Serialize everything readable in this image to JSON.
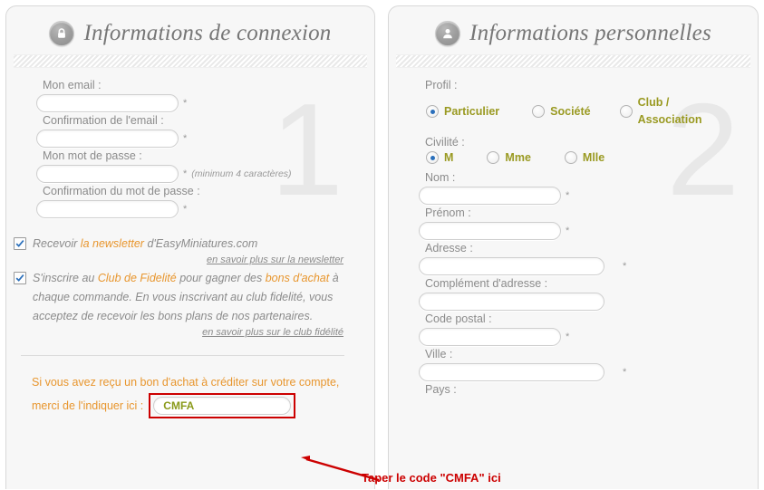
{
  "left_panel": {
    "icon": "lock-icon",
    "title": "Informations de connexion",
    "watermark": "1",
    "fields": [
      {
        "label": "Mon email :",
        "value": "",
        "required": "*",
        "hint": ""
      },
      {
        "label": "Confirmation de l'email :",
        "value": "",
        "required": "*",
        "hint": ""
      },
      {
        "label": "Mon mot de passe :",
        "value": "",
        "required": "*",
        "hint": "(minimum 4 caractères)"
      },
      {
        "label": "Confirmation du mot de passe :",
        "value": "",
        "required": "*",
        "hint": ""
      }
    ],
    "newsletter": {
      "checked": true,
      "text_before": "Recevoir ",
      "text_highlight": "la newsletter",
      "text_after": " d'EasyMiniatures.com",
      "link": "en savoir plus sur la newsletter"
    },
    "loyalty": {
      "checked": true,
      "seg1": "S'inscrire au ",
      "seg2": "Club de Fidelité",
      "seg3": " pour gagner des ",
      "seg4": "bons d'achat",
      "seg5": " à chaque commande. En vous inscrivant au club fidelité, vous acceptez de recevoir les bons plans de nos partenaires.",
      "link": "en savoir plus sur le club fidélité"
    },
    "voucher": {
      "line1": "Si vous avez reçu un bon d'achat à créditer sur votre compte,",
      "line2": "merci de l'indiquer ici :",
      "value": "CMFA",
      "placeholder": ""
    }
  },
  "right_panel": {
    "icon": "user-icon",
    "title": "Informations personnelles",
    "watermark": "2",
    "profil": {
      "label": "Profil :",
      "options": [
        {
          "label": "Particulier",
          "selected": true
        },
        {
          "label": "Société",
          "selected": false
        },
        {
          "label": "Club / Association",
          "selected": false
        }
      ]
    },
    "civilite": {
      "label": "Civilité :",
      "options": [
        {
          "label": "M",
          "selected": true
        },
        {
          "label": "Mme",
          "selected": false
        },
        {
          "label": "Mlle",
          "selected": false
        }
      ]
    },
    "fields": [
      {
        "label": "Nom :",
        "value": "",
        "required": "*",
        "width": "narrow"
      },
      {
        "label": "Prénom :",
        "value": "",
        "required": "*",
        "width": "narrow"
      },
      {
        "label": "Adresse :",
        "value": "",
        "required": "*",
        "width": "wide"
      },
      {
        "label": "Complément d'adresse :",
        "value": "",
        "required": "",
        "width": "wide"
      },
      {
        "label": "Code postal :",
        "value": "",
        "required": "*",
        "width": "narrow"
      },
      {
        "label": "Ville :",
        "value": "",
        "required": "*",
        "width": "wide"
      },
      {
        "label": "Pays :",
        "value": "",
        "required": "",
        "width": "wide"
      }
    ]
  },
  "annotation": {
    "text": "Taper le code \"CMFA\" ici",
    "color": "#cc0000"
  },
  "colors": {
    "accent_orange": "#e8962e",
    "label_gray": "#8b8b8b",
    "olive": "#9a9a22",
    "panel_bg": "#f7f7f7",
    "annotation_red": "#cc0000"
  }
}
